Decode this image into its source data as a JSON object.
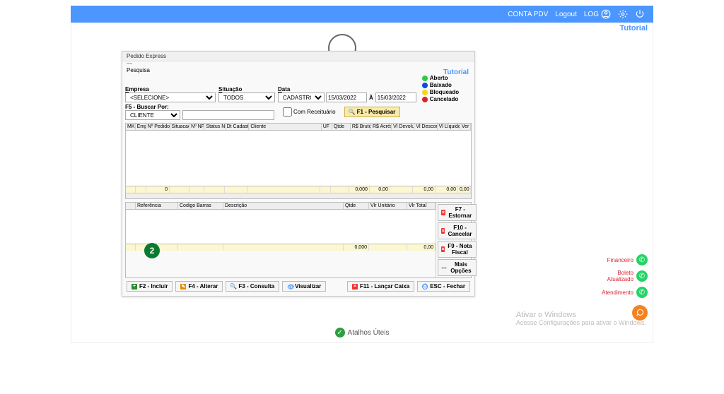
{
  "topbar": {
    "account": "CONTA PDV",
    "logout": "Logout",
    "log": "LOG"
  },
  "tutorial": "Tutorial",
  "dialog": {
    "title": "Pedido Express",
    "section_pesquisa": "Pesquisa",
    "empresa_label": "Empresa",
    "empresa_value": "<SELECIONE>",
    "situacao_label": "Situação",
    "situacao_value": "TODOS",
    "data_label": "Data",
    "data_tipo": "CADASTRO",
    "date_from": "15/03/2022",
    "date_sep": "À",
    "date_to": "15/03/2022",
    "buscar_label": "F5 - Buscar Por:",
    "buscar_tipo": "CLIENTE",
    "buscar_value": "",
    "receituario": "Com Receituário",
    "pesquisar": "F1 - Pesquisar"
  },
  "legend": {
    "aberto": "Aberto",
    "baixado": "Baixado",
    "bloqueado": "Bloqueado",
    "cancelado": "Cancelado",
    "colors": {
      "aberto": "#2ecc40",
      "baixado": "#1049e3",
      "bloqueado": "#f4d41f",
      "cancelado": "#e02121"
    }
  },
  "grid": {
    "cols": [
      "MK",
      "Emp",
      "Nº Pedido",
      "Situacao",
      "Nº NF",
      "Status NF",
      "Dt Cadastro",
      "Cliente",
      "UF",
      "Qtde",
      "R$ Bruto",
      "R$ Acrés",
      "Vl Devoluç",
      "Vl Descont",
      "Vl Líquido",
      "Ver"
    ],
    "widths": [
      16,
      18,
      42,
      34,
      26,
      36,
      42,
      130,
      18,
      32,
      36,
      36,
      40,
      40,
      40,
      18
    ],
    "totals": [
      "",
      "",
      "0",
      "",
      "",
      "",
      "",
      "",
      "",
      "",
      "0,000",
      "0,00",
      "",
      "0,00",
      "0,00",
      "0,00"
    ]
  },
  "grid2": {
    "cols": [
      "",
      "Referência",
      "Codigo Barras",
      "Descrição",
      "Qtde",
      "Vlr Unitário",
      "Vlr Total"
    ],
    "widths": [
      14,
      60,
      64,
      170,
      36,
      54,
      40
    ],
    "total_qtde": "0,000",
    "total_val": "0,00",
    "side": {
      "f7": "F7 - Estornar",
      "f10": "F10 - Cancelar",
      "f9": "F9 - Nota Fiscal",
      "mais": "Mais Opções"
    }
  },
  "btnbar": {
    "f2": "F2 - Incluir",
    "f4": "F4 - Alterar",
    "f3": "F3 - Consulta",
    "viz": "Visualizar",
    "f11": "F11 - Lançar Caixa",
    "esc": "ESC - Fechar"
  },
  "step": "2",
  "float": {
    "financeiro": "Financeiro",
    "boleto1": "Boleto",
    "boleto2": "Atualizado",
    "atendimento": "Atendimento"
  },
  "watermark": {
    "l1": "Ativar o Windows",
    "l2": "Acesse Configurações para ativar o Windows."
  },
  "bottom": "Atalhos Úteis"
}
